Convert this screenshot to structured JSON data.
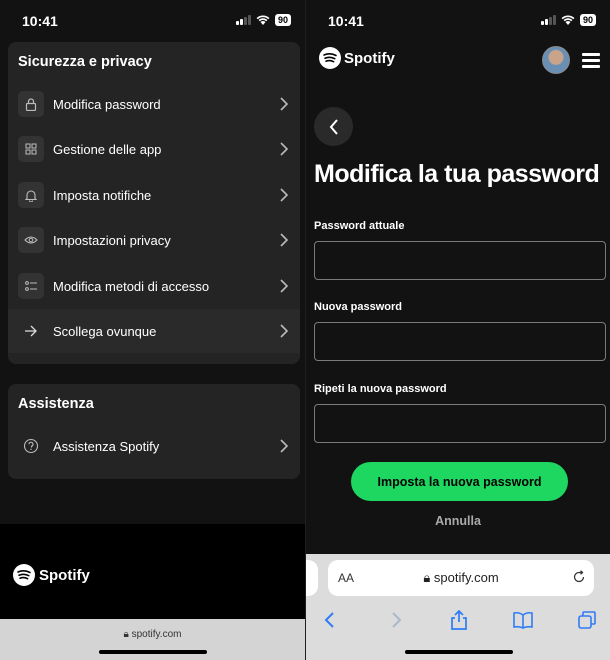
{
  "left": {
    "status": {
      "time": "10:41",
      "battery": "90"
    },
    "security": {
      "heading": "Sicurezza e privacy",
      "items": [
        {
          "label": "Modifica password",
          "icon": "lock-icon"
        },
        {
          "label": "Gestione delle app",
          "icon": "grid-icon"
        },
        {
          "label": "Imposta notifiche",
          "icon": "bell-icon"
        },
        {
          "label": "Impostazioni privacy",
          "icon": "eye-icon"
        },
        {
          "label": "Modifica metodi di accesso",
          "icon": "list-icon"
        },
        {
          "label": "Scollega ovunque",
          "icon": "arrow-right-icon"
        }
      ]
    },
    "support": {
      "heading": "Assistenza",
      "items": [
        {
          "label": "Assistenza Spotify",
          "icon": "question-icon"
        }
      ]
    },
    "splash_logo": "Spotify",
    "url": "spotify.com"
  },
  "right": {
    "status": {
      "time": "10:41",
      "battery": "90"
    },
    "header": {
      "logo": "Spotify"
    },
    "title": "Modifica la tua password",
    "fields": [
      {
        "label": "Password attuale",
        "value": ""
      },
      {
        "label": "Nuova password",
        "value": ""
      },
      {
        "label": "Ripeti la nuova password",
        "value": ""
      }
    ],
    "submit_label": "Imposta la nuova password",
    "cancel_label": "Annulla",
    "safari": {
      "text_size": "AA",
      "url": "spotify.com"
    }
  },
  "colors": {
    "accent": "#1ed760",
    "background": "#121212",
    "card": "#242424"
  }
}
